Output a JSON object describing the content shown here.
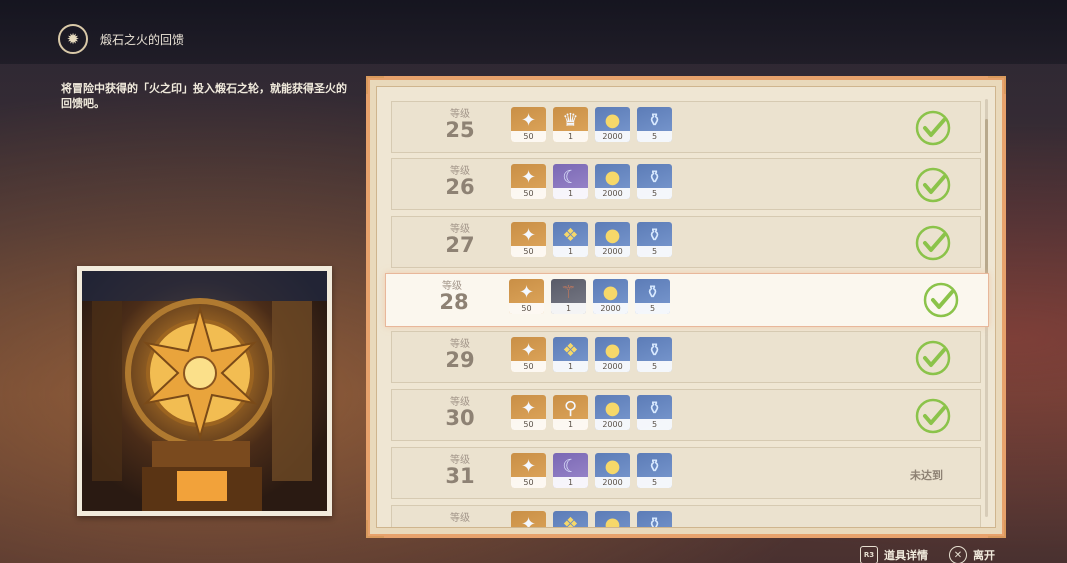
{
  "header": {
    "title": "煅石之火的回馈",
    "icon": "furnace-emblem-icon"
  },
  "description": "将冒险中获得的「火之印」投入煅石之轮，就能获得圣火的回馈吧。",
  "level_label": "等级",
  "rows": [
    {
      "level": "25",
      "claimed": true,
      "highlight": false,
      "items": [
        {
          "icon": "primogem-icon",
          "qty": "50",
          "quality": "q4"
        },
        {
          "icon": "crown-icon",
          "qty": "1",
          "quality": "q4"
        },
        {
          "icon": "mora-icon",
          "qty": "2000",
          "quality": "q3"
        },
        {
          "icon": "heros-wit-icon",
          "qty": "5",
          "quality": "q3b"
        }
      ]
    },
    {
      "level": "26",
      "claimed": true,
      "highlight": false,
      "items": [
        {
          "icon": "primogem-icon",
          "qty": "50",
          "quality": "q4"
        },
        {
          "icon": "moon-bell-icon",
          "qty": "1",
          "quality": "q5"
        },
        {
          "icon": "mora-icon",
          "qty": "2000",
          "quality": "q3"
        },
        {
          "icon": "heros-wit-icon",
          "qty": "5",
          "quality": "q3b"
        }
      ]
    },
    {
      "level": "27",
      "claimed": true,
      "highlight": false,
      "items": [
        {
          "icon": "primogem-icon",
          "qty": "50",
          "quality": "q4"
        },
        {
          "icon": "crystal-ore-icon",
          "qty": "1",
          "quality": "q3"
        },
        {
          "icon": "mora-icon",
          "qty": "2000",
          "quality": "q3"
        },
        {
          "icon": "heros-wit-icon",
          "qty": "5",
          "quality": "q3b"
        }
      ]
    },
    {
      "level": "28",
      "claimed": true,
      "highlight": true,
      "items": [
        {
          "icon": "primogem-icon",
          "qty": "50",
          "quality": "q4"
        },
        {
          "icon": "wand-icon",
          "qty": "1",
          "quality": "qd"
        },
        {
          "icon": "mora-icon",
          "qty": "2000",
          "quality": "q3"
        },
        {
          "icon": "heros-wit-icon",
          "qty": "5",
          "quality": "q3b"
        }
      ]
    },
    {
      "level": "29",
      "claimed": true,
      "highlight": false,
      "items": [
        {
          "icon": "primogem-icon",
          "qty": "50",
          "quality": "q4"
        },
        {
          "icon": "crystal-ore-icon",
          "qty": "1",
          "quality": "q3"
        },
        {
          "icon": "mora-icon",
          "qty": "2000",
          "quality": "q3"
        },
        {
          "icon": "heros-wit-icon",
          "qty": "5",
          "quality": "q3b"
        }
      ]
    },
    {
      "level": "30",
      "claimed": true,
      "highlight": false,
      "items": [
        {
          "icon": "primogem-icon",
          "qty": "50",
          "quality": "q4"
        },
        {
          "icon": "scepter-icon",
          "qty": "1",
          "quality": "q4"
        },
        {
          "icon": "mora-icon",
          "qty": "2000",
          "quality": "q3"
        },
        {
          "icon": "heros-wit-icon",
          "qty": "5",
          "quality": "q3b"
        }
      ]
    },
    {
      "level": "31",
      "claimed": false,
      "status": "未达到",
      "highlight": false,
      "items": [
        {
          "icon": "primogem-icon",
          "qty": "50",
          "quality": "q4"
        },
        {
          "icon": "moon-bell-icon",
          "qty": "1",
          "quality": "q5"
        },
        {
          "icon": "mora-icon",
          "qty": "2000",
          "quality": "q3"
        },
        {
          "icon": "heros-wit-icon",
          "qty": "5",
          "quality": "q3b"
        }
      ]
    },
    {
      "level": "",
      "claimed": false,
      "status": "",
      "highlight": false,
      "partial": true,
      "items": [
        {
          "icon": "primogem-icon",
          "qty": "",
          "quality": "q4"
        },
        {
          "icon": "crystal-ore-icon",
          "qty": "",
          "quality": "q3"
        },
        {
          "icon": "mora-icon",
          "qty": "",
          "quality": "q3"
        },
        {
          "icon": "heros-wit-icon",
          "qty": "",
          "quality": "q3b"
        }
      ]
    }
  ],
  "footer": {
    "details_label": "道具详情",
    "details_key": "R3",
    "leave_label": "离开"
  },
  "colors": {
    "check": "#8bc34a",
    "panel_border": "#e7a26c"
  }
}
